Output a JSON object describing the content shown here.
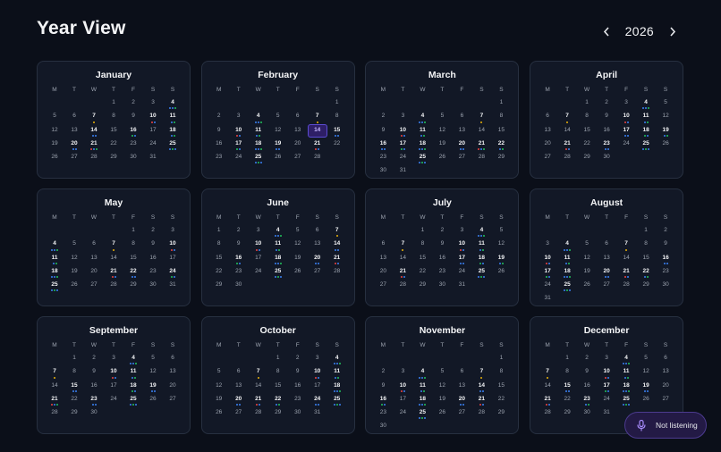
{
  "header": {
    "title": "Year View",
    "year": "2026"
  },
  "weekdays": [
    "M",
    "T",
    "W",
    "T",
    "F",
    "S",
    "S"
  ],
  "colors": {
    "yellow": "#eab308",
    "blue": "#3b82f6",
    "green": "#22c55e",
    "red": "#ef4444",
    "purple": "#8b5cf6"
  },
  "today": {
    "month": 2,
    "day": 14
  },
  "months": [
    {
      "name": "January",
      "offset": 3,
      "days": 31,
      "events": {
        "4": [
          "blue",
          "blue",
          "green"
        ],
        "7": [
          "yellow"
        ],
        "10": [
          "red",
          "blue"
        ],
        "11": [
          "blue",
          "green"
        ],
        "14": [
          "blue",
          "blue"
        ],
        "16": [
          "green",
          "blue"
        ],
        "18": [
          "blue",
          "green"
        ],
        "20": [
          "blue",
          "blue"
        ],
        "21": [
          "red",
          "blue",
          "green"
        ],
        "25": [
          "blue",
          "green",
          "blue"
        ]
      }
    },
    {
      "name": "February",
      "offset": 6,
      "days": 28,
      "events": {
        "4": [
          "blue",
          "blue",
          "green"
        ],
        "7": [
          "yellow"
        ],
        "10": [
          "red",
          "blue"
        ],
        "11": [
          "blue",
          "green"
        ],
        "14": [],
        "15": [
          "blue",
          "blue"
        ],
        "17": [
          "green",
          "blue"
        ],
        "18": [
          "blue",
          "blue",
          "green"
        ],
        "19": [
          "blue",
          "blue"
        ],
        "21": [
          "red",
          "blue"
        ],
        "25": [
          "blue",
          "green",
          "blue"
        ]
      }
    },
    {
      "name": "March",
      "offset": 6,
      "days": 31,
      "events": {
        "4": [
          "blue",
          "blue",
          "green"
        ],
        "7": [
          "yellow"
        ],
        "10": [
          "red",
          "blue"
        ],
        "11": [
          "blue",
          "green"
        ],
        "16": [
          "blue",
          "blue"
        ],
        "17": [
          "green",
          "blue"
        ],
        "18": [
          "blue",
          "blue",
          "green"
        ],
        "20": [
          "blue",
          "blue"
        ],
        "21": [
          "red",
          "blue",
          "green"
        ],
        "22": [
          "blue",
          "green"
        ],
        "25": [
          "blue",
          "green",
          "blue"
        ]
      }
    },
    {
      "name": "April",
      "offset": 2,
      "days": 30,
      "events": {
        "4": [
          "blue",
          "blue",
          "green"
        ],
        "7": [
          "yellow"
        ],
        "10": [
          "red",
          "blue"
        ],
        "11": [
          "blue",
          "green"
        ],
        "17": [
          "blue",
          "blue"
        ],
        "18": [
          "green",
          "blue"
        ],
        "19": [
          "blue",
          "green"
        ],
        "21": [
          "red",
          "blue"
        ],
        "23": [
          "blue",
          "blue"
        ],
        "25": [
          "blue",
          "green",
          "blue"
        ]
      }
    },
    {
      "name": "May",
      "offset": 4,
      "days": 31,
      "events": {
        "4": [
          "blue",
          "blue",
          "green"
        ],
        "7": [
          "yellow"
        ],
        "10": [
          "red",
          "blue"
        ],
        "11": [
          "blue",
          "green"
        ],
        "18": [
          "blue",
          "blue",
          "green"
        ],
        "21": [
          "red",
          "blue"
        ],
        "22": [
          "blue",
          "blue"
        ],
        "24": [
          "green",
          "blue"
        ],
        "25": [
          "blue",
          "green",
          "blue"
        ]
      }
    },
    {
      "name": "June",
      "offset": 0,
      "days": 30,
      "events": {
        "4": [
          "blue",
          "blue",
          "green"
        ],
        "7": [
          "yellow"
        ],
        "10": [
          "red",
          "blue"
        ],
        "11": [
          "blue",
          "green"
        ],
        "14": [
          "blue",
          "blue"
        ],
        "16": [
          "green",
          "blue"
        ],
        "18": [
          "blue",
          "blue",
          "green"
        ],
        "20": [
          "blue",
          "blue"
        ],
        "21": [
          "red",
          "blue"
        ],
        "25": [
          "blue",
          "green",
          "blue"
        ]
      }
    },
    {
      "name": "July",
      "offset": 2,
      "days": 31,
      "events": {
        "4": [
          "blue",
          "blue",
          "green"
        ],
        "7": [
          "yellow"
        ],
        "10": [
          "red",
          "blue"
        ],
        "11": [
          "blue",
          "green"
        ],
        "17": [
          "blue",
          "blue"
        ],
        "18": [
          "green",
          "blue"
        ],
        "19": [
          "blue",
          "green"
        ],
        "21": [
          "red",
          "blue"
        ],
        "25": [
          "blue",
          "green",
          "blue"
        ]
      }
    },
    {
      "name": "August",
      "offset": 5,
      "days": 31,
      "events": {
        "4": [
          "blue",
          "blue",
          "green"
        ],
        "7": [
          "yellow"
        ],
        "10": [
          "red",
          "blue"
        ],
        "11": [
          "blue",
          "green"
        ],
        "16": [
          "blue",
          "blue"
        ],
        "17": [
          "green",
          "blue"
        ],
        "18": [
          "blue",
          "blue",
          "green"
        ],
        "20": [
          "blue",
          "blue"
        ],
        "21": [
          "red",
          "blue"
        ],
        "22": [
          "blue",
          "green"
        ],
        "25": [
          "blue",
          "green",
          "blue"
        ]
      }
    },
    {
      "name": "September",
      "offset": 1,
      "days": 30,
      "events": {
        "4": [
          "blue",
          "blue",
          "green"
        ],
        "7": [
          "yellow"
        ],
        "10": [
          "red",
          "blue"
        ],
        "11": [
          "blue",
          "green"
        ],
        "15": [
          "blue",
          "blue"
        ],
        "18": [
          "green",
          "blue"
        ],
        "19": [
          "blue",
          "blue"
        ],
        "21": [
          "red",
          "blue",
          "green"
        ],
        "23": [
          "blue",
          "blue"
        ],
        "25": [
          "blue",
          "green",
          "blue"
        ]
      }
    },
    {
      "name": "October",
      "offset": 3,
      "days": 31,
      "events": {
        "4": [
          "blue",
          "blue",
          "green"
        ],
        "7": [
          "yellow"
        ],
        "10": [
          "red",
          "blue"
        ],
        "11": [
          "blue",
          "green"
        ],
        "18": [
          "blue",
          "blue",
          "green"
        ],
        "20": [
          "blue",
          "blue"
        ],
        "21": [
          "red",
          "blue"
        ],
        "22": [
          "blue",
          "green"
        ],
        "24": [
          "blue",
          "blue"
        ],
        "25": [
          "blue",
          "green",
          "blue"
        ]
      }
    },
    {
      "name": "November",
      "offset": 6,
      "days": 30,
      "events": {
        "4": [
          "blue",
          "blue",
          "green"
        ],
        "7": [
          "yellow"
        ],
        "10": [
          "red",
          "blue"
        ],
        "11": [
          "blue",
          "green"
        ],
        "14": [
          "blue",
          "blue"
        ],
        "16": [
          "green",
          "blue"
        ],
        "18": [
          "blue",
          "blue",
          "green"
        ],
        "20": [
          "blue",
          "blue"
        ],
        "21": [
          "red",
          "blue"
        ],
        "25": [
          "blue",
          "green",
          "blue"
        ]
      }
    },
    {
      "name": "December",
      "offset": 1,
      "days": 31,
      "events": {
        "4": [
          "blue",
          "blue",
          "green"
        ],
        "7": [
          "yellow"
        ],
        "10": [
          "red",
          "blue"
        ],
        "11": [
          "blue",
          "green"
        ],
        "15": [
          "blue",
          "blue"
        ],
        "17": [
          "green",
          "blue"
        ],
        "18": [
          "blue",
          "blue",
          "green"
        ],
        "19": [
          "blue",
          "blue"
        ],
        "21": [
          "red",
          "blue"
        ],
        "23": [
          "blue",
          "green"
        ],
        "25": [
          "blue",
          "green",
          "blue"
        ]
      }
    }
  ],
  "voice": {
    "label": "Not listening",
    "icon": "microphone-icon"
  }
}
